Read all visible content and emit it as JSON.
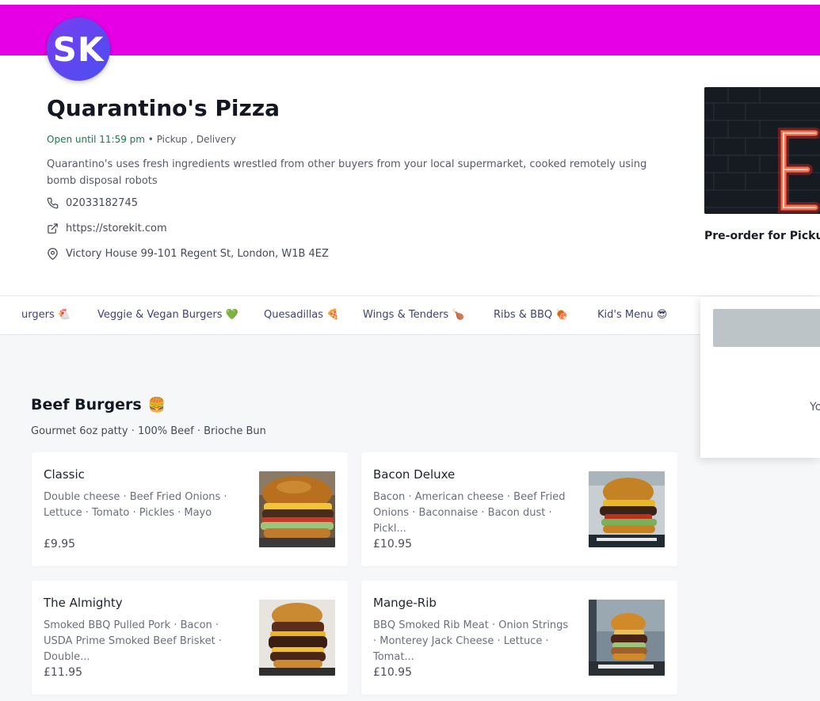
{
  "store": {
    "initials": "SK",
    "name": "Quarantino's Pizza",
    "open_status": "Open until 11:59 pm",
    "modes": "Pickup , Delivery",
    "description": "Quarantino's uses fresh ingredients wrestled from other buyers from your local supermarket, cooked remotely using bomb disposal robots",
    "phone": "02033182745",
    "website": "https://storekit.com",
    "address": "Victory House 99-101 Regent St, London, W1B 4EZ"
  },
  "preorder": {
    "title": "Pre-order for Pickup"
  },
  "categories": [
    {
      "label": "urgers",
      "emoji": "🐔"
    },
    {
      "label": "Veggie & Vegan Burgers",
      "emoji": "💚"
    },
    {
      "label": "Quesadillas",
      "emoji": "🍕"
    },
    {
      "label": "Wings & Tenders",
      "emoji": "🍗"
    },
    {
      "label": "Ribs & BBQ",
      "emoji": "🍖"
    },
    {
      "label": "Kid's Menu",
      "emoji": "😎"
    }
  ],
  "sidebar": {
    "text": "Yo"
  },
  "section": {
    "title": "Beef Burgers",
    "emoji": "🍔",
    "subtitle": "Gourmet 6oz patty · 100% Beef · Brioche Bun"
  },
  "items": [
    {
      "name": "Classic",
      "ingredients": "Double cheese · Beef Fried Onions · Lettuce · Tomato · Pickles · Mayo",
      "price": "£9.95"
    },
    {
      "name": "Bacon Deluxe",
      "ingredients": "Bacon · American cheese · Beef Fried Onions · Baconnaise · Bacon dust · Pickl...",
      "price": "£10.95"
    },
    {
      "name": "The Almighty",
      "ingredients": "Smoked BBQ Pulled Pork · Bacon · USDA Prime Smoked Beef Brisket · Double...",
      "price": "£11.95"
    },
    {
      "name": "Mange-Rib",
      "ingredients": "BBQ Smoked Rib Meat · Onion Strings · Monterey Jack Cheese · Lettuce · Tomat...",
      "price": "£10.95"
    }
  ],
  "colors": {
    "header": "#e500e5",
    "avatar": "#5a45f0",
    "open_status": "#1a7a4c",
    "category_text": "#3d4470"
  }
}
